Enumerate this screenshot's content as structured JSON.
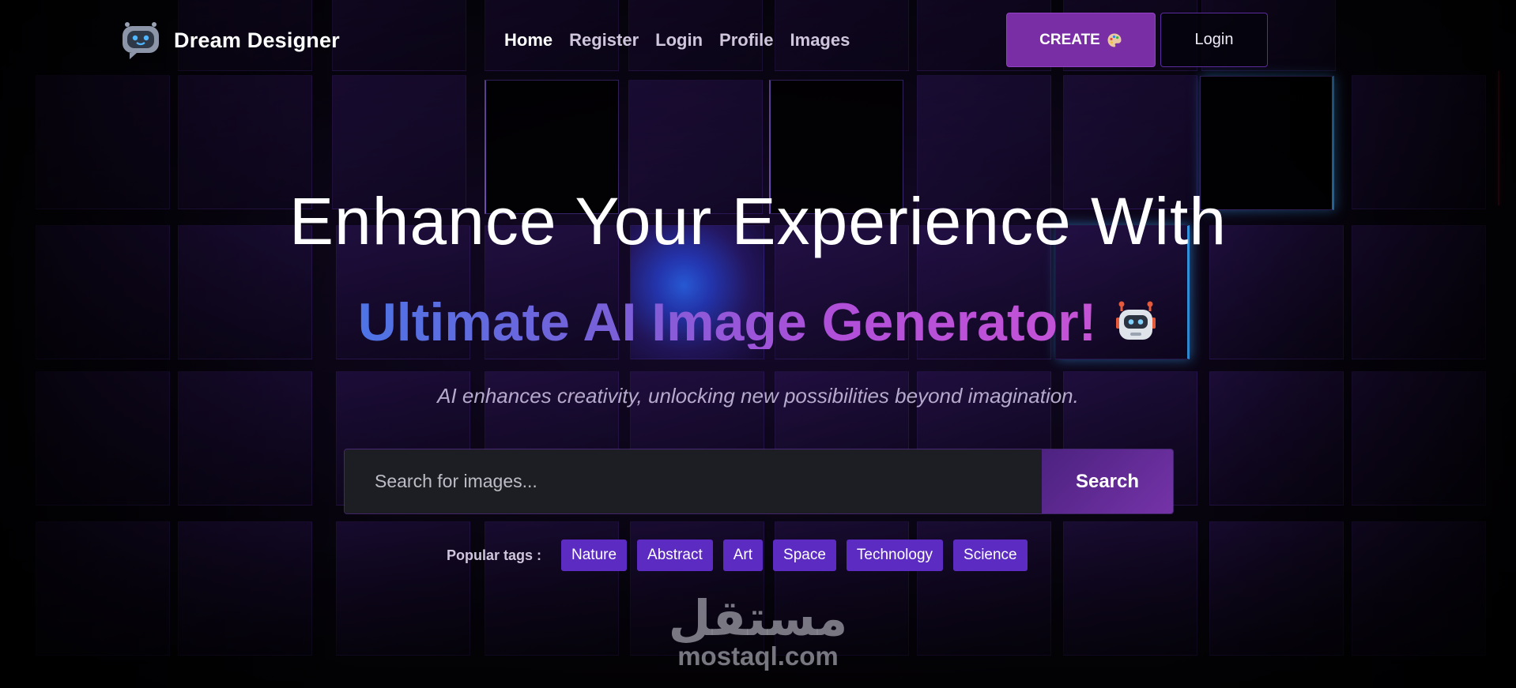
{
  "brand": {
    "name": "Dream Designer",
    "icon": "robot-chat-icon"
  },
  "nav": {
    "links": [
      {
        "label": "Home",
        "active": true
      },
      {
        "label": "Register",
        "active": false
      },
      {
        "label": "Login",
        "active": false
      },
      {
        "label": "Profile",
        "active": false
      },
      {
        "label": "Images",
        "active": false
      }
    ],
    "create_label": "CREATE",
    "create_icon": "palette-icon",
    "login_label": "Login"
  },
  "hero": {
    "title": "Enhance Your Experience With",
    "subtitle": "Ultimate AI Image Generator!",
    "subtitle_icon": "robot-icon",
    "tagline": "AI enhances creativity, unlocking new possibilities beyond imagination."
  },
  "search": {
    "placeholder": "Search for images...",
    "value": "",
    "button_label": "Search"
  },
  "tags": {
    "label": "Popular tags :",
    "items": [
      "Nature",
      "Abstract",
      "Art",
      "Space",
      "Technology",
      "Science"
    ]
  },
  "watermark": {
    "arabic": "مستقل",
    "latin": "mostaql.com"
  },
  "colors": {
    "accent": "#7a2ea6",
    "tag_bg": "#5b2bc2",
    "gradient_start": "#4d74e6",
    "gradient_end": "#c653d6"
  }
}
